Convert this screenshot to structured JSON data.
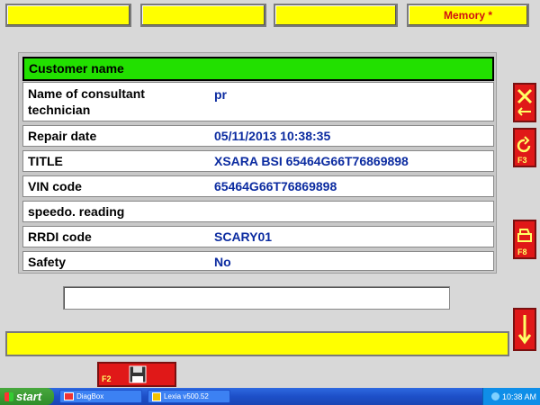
{
  "top_buttons": [
    "",
    "",
    "",
    "Memory *"
  ],
  "customer_header": "Customer name",
  "fields": [
    {
      "label": "Name of consultant\ntechnician",
      "value": "pr"
    },
    {
      "label": "Repair date",
      "value": "05/11/2013 10:38:35"
    },
    {
      "label": "TITLE",
      "value": "XSARA BSI 65464G66T76869898"
    },
    {
      "label": "VIN code",
      "value": "65464G66T76869898"
    },
    {
      "label": "speedo. reading",
      "value": ""
    },
    {
      "label": "RRDI code",
      "value": "SCARY01"
    },
    {
      "label": "Safety",
      "value": "No"
    }
  ],
  "side_buttons": {
    "f3_label": "F3",
    "f8_label": "F8"
  },
  "save_button": {
    "key": "F2"
  },
  "taskbar": {
    "start_label": "start",
    "tasks": [
      "DiagBox",
      "Lexia v500.52"
    ],
    "clock": "10:38 AM"
  },
  "colors": {
    "accent_yellow": "#ffff00",
    "header_green": "#22e000",
    "value_blue": "#0b2ba0",
    "action_red": "#e01818"
  }
}
